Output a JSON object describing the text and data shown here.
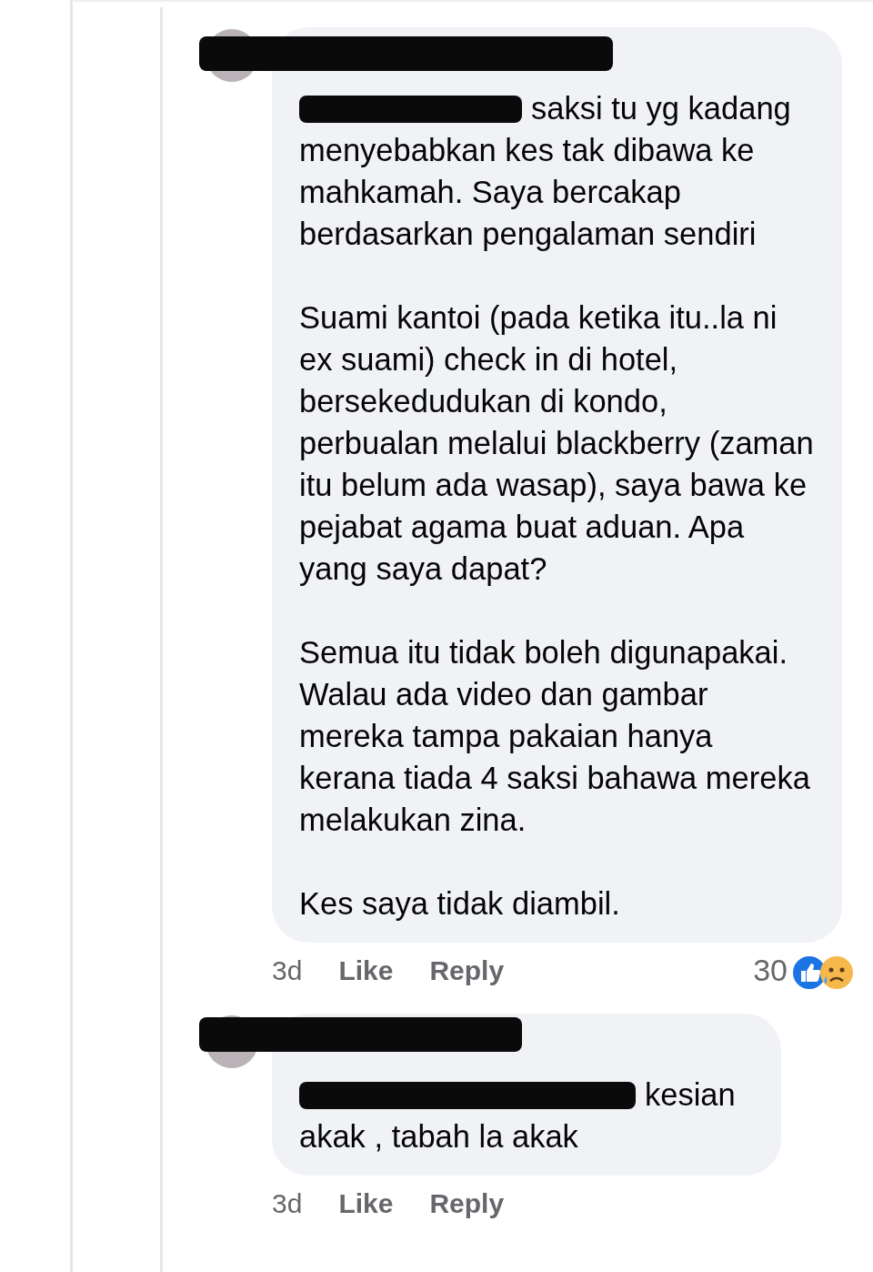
{
  "comments": [
    {
      "name_redacted": true,
      "mention_redacted": true,
      "paragraphs": [
        "saksi tu yg kadang menyebabkan kes tak dibawa ke mahkamah. Saya bercakap berdasarkan pengalaman sendiri",
        "Suami kantoi (pada ketika itu..la ni ex suami) check in di hotel, bersekedudukan di kondo, perbualan melalui blackberry (zaman itu belum ada wasap), saya bawa ke pejabat agama buat aduan. Apa yang saya dapat?",
        "Semua itu tidak boleh digunapakai. Walau ada video dan gambar mereka tampa pakaian hanya kerana tiada 4 saksi bahawa mereka melakukan zina.",
        "Kes saya tidak diambil."
      ],
      "time": "3d",
      "like": "Like",
      "reply": "Reply",
      "reaction_count": "30"
    },
    {
      "name_redacted": true,
      "mention_redacted": true,
      "paragraphs": [
        "kesian akak , tabah la akak"
      ],
      "time": "3d",
      "like": "Like",
      "reply": "Reply"
    }
  ]
}
